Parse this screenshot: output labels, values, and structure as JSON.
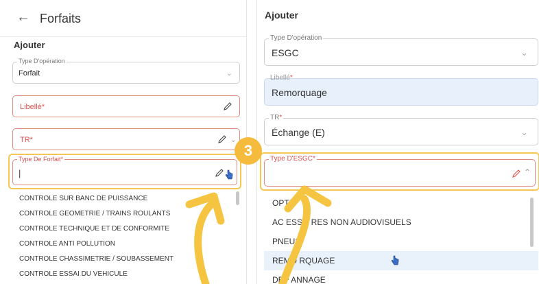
{
  "left": {
    "header": {
      "title": "Forfaits",
      "back_icon": "arrow-left-icon"
    },
    "section_title": "Ajouter",
    "type_operation": {
      "label": "Type D'opération",
      "value": "Forfait"
    },
    "libelle": {
      "label": "Libellé",
      "required": "*"
    },
    "tr": {
      "label": "TR",
      "required": "*"
    },
    "type_forfait": {
      "label": "Type De Forfait",
      "required": "*",
      "value": "|"
    },
    "options": [
      "CONTROLE SUR BANC DE PUISSANCE",
      "CONTROLE GEOMETRIE / TRAINS ROULANTS",
      "CONTROLE TECHNIQUE ET DE CONFORMITE",
      "CONTROLE ANTI POLLUTION",
      "CONTROLE CHASSIMETRIE / SOUBASSEMENT",
      "CONTROLE ESSAI DU VEHICULE"
    ]
  },
  "right": {
    "section_title": "Ajouter",
    "type_operation": {
      "label": "Type D'opération",
      "value": "ESGC"
    },
    "libelle": {
      "label": "Libellé",
      "required": "*",
      "value": "Remorquage"
    },
    "tr": {
      "label": "TR",
      "required": "*",
      "value": "Échange (E)"
    },
    "type_esgc": {
      "label": "Type D'ESGC",
      "required": "*"
    },
    "options": [
      "OPTI",
      "AC   ESSO  RES NON AUDIOVISUELS",
      "PNEUS",
      "REMO  RQUAGE",
      "DEP  ANNAGE"
    ]
  },
  "step_badge": "3",
  "colors": {
    "accent": "#f4bb3c",
    "error": "#d9534f",
    "selected_row": "#e9f1fb",
    "filled_bg": "#e8f0fb"
  }
}
